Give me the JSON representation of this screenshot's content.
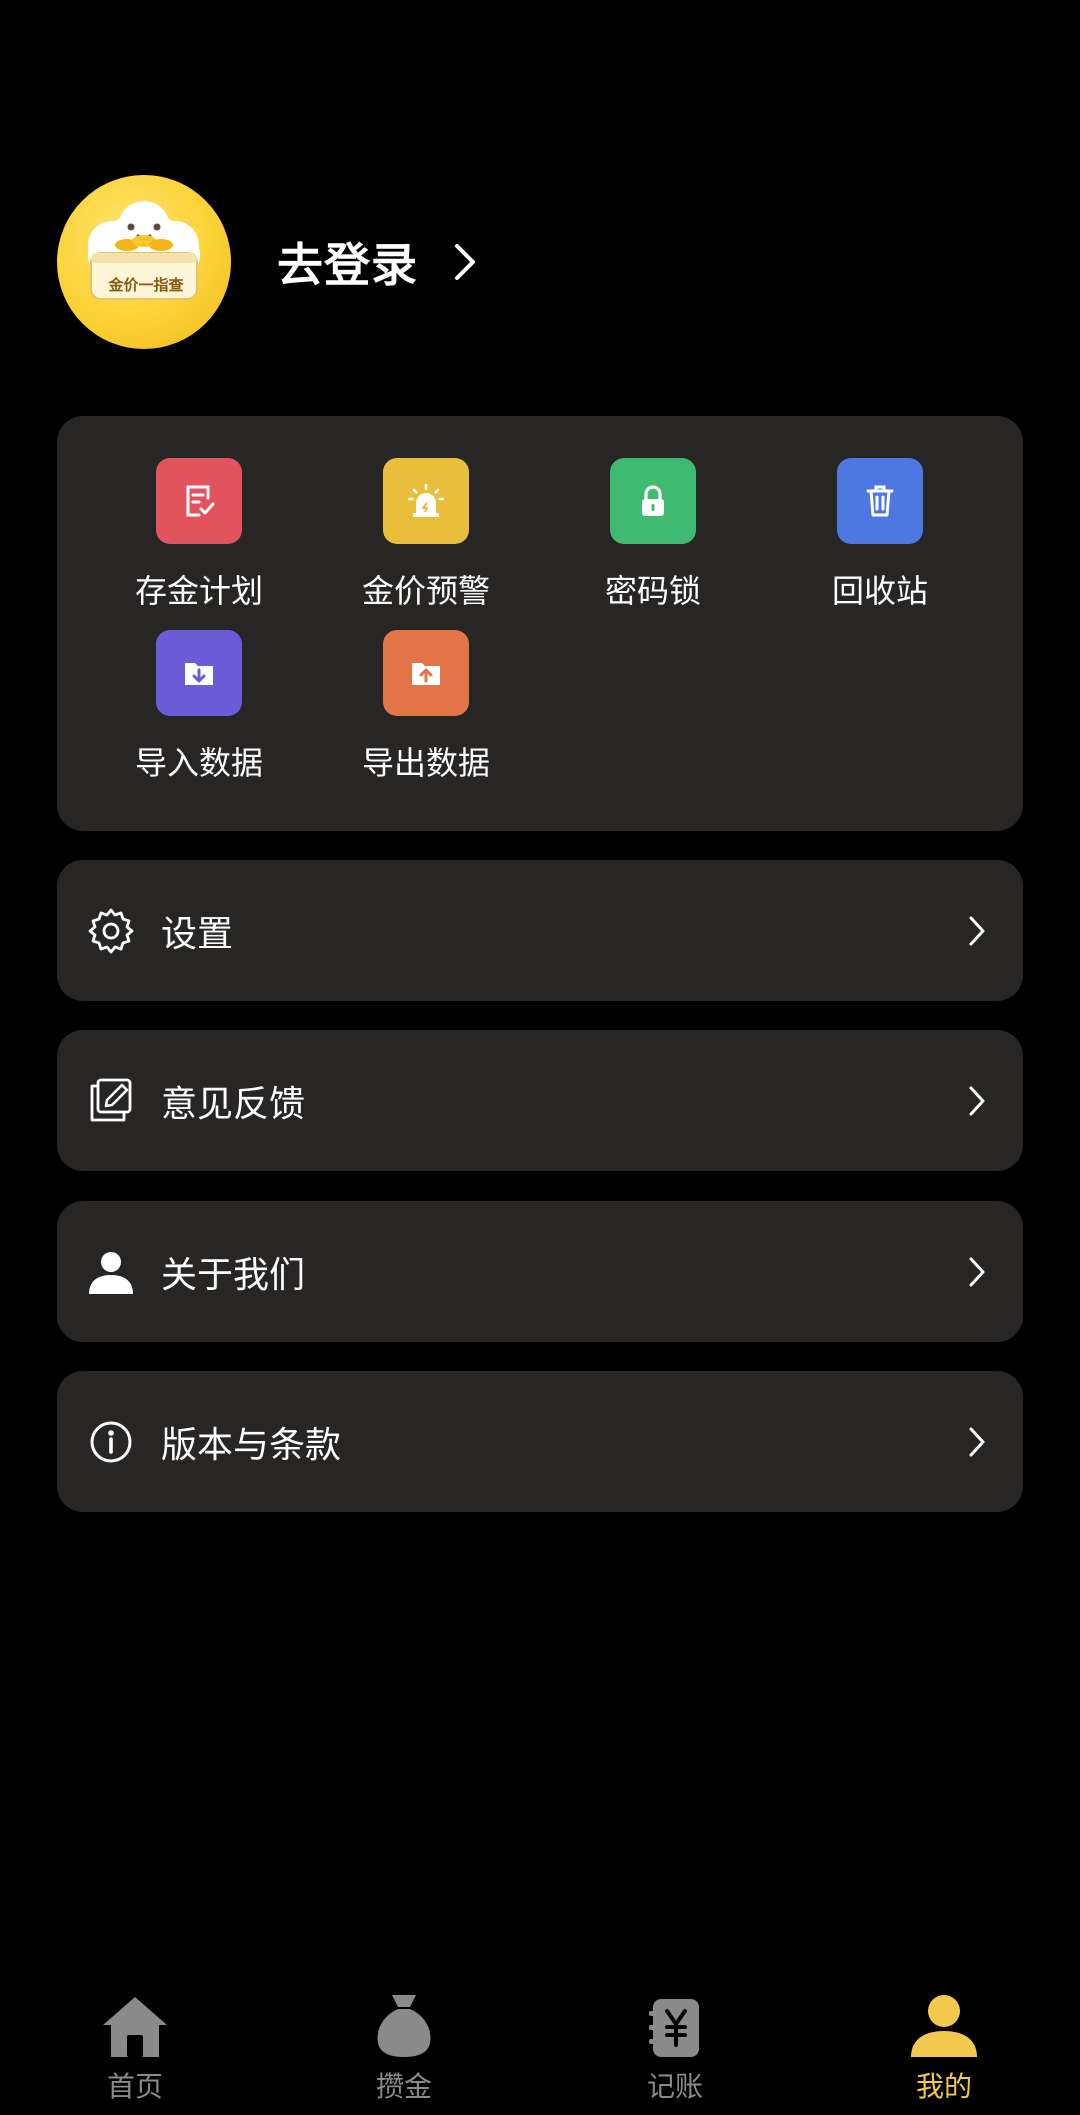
{
  "profile": {
    "login_text": "去登录",
    "avatar_badge": "金价一指查"
  },
  "tools": [
    {
      "label": "存金计划",
      "icon": "plan-check-icon",
      "color": "#e1545e"
    },
    {
      "label": "金价预警",
      "icon": "alarm-light-icon",
      "color": "#e8bf3b"
    },
    {
      "label": "密码锁",
      "icon": "lock-icon",
      "color": "#3fba72"
    },
    {
      "label": "回收站",
      "icon": "trash-icon",
      "color": "#4d78e2"
    },
    {
      "label": "导入数据",
      "icon": "folder-import-icon",
      "color": "#6c5bd6"
    },
    {
      "label": "导出数据",
      "icon": "folder-export-icon",
      "color": "#e27447"
    }
  ],
  "menu": [
    {
      "label": "设置",
      "icon": "gear-icon"
    },
    {
      "label": "意见反馈",
      "icon": "feedback-edit-icon"
    },
    {
      "label": "关于我们",
      "icon": "person-icon"
    },
    {
      "label": "版本与条款",
      "icon": "info-icon"
    }
  ],
  "tabbar": [
    {
      "label": "首页",
      "icon": "home-icon",
      "active": false
    },
    {
      "label": "攒金",
      "icon": "money-bag-icon",
      "active": false
    },
    {
      "label": "记账",
      "icon": "ledger-yen-icon",
      "active": false
    },
    {
      "label": "我的",
      "icon": "user-icon",
      "active": true
    }
  ],
  "colors": {
    "background": "#000000",
    "card": "#282624",
    "accent": "#f2c94c",
    "inactive_tab": "#8a8a8a"
  }
}
